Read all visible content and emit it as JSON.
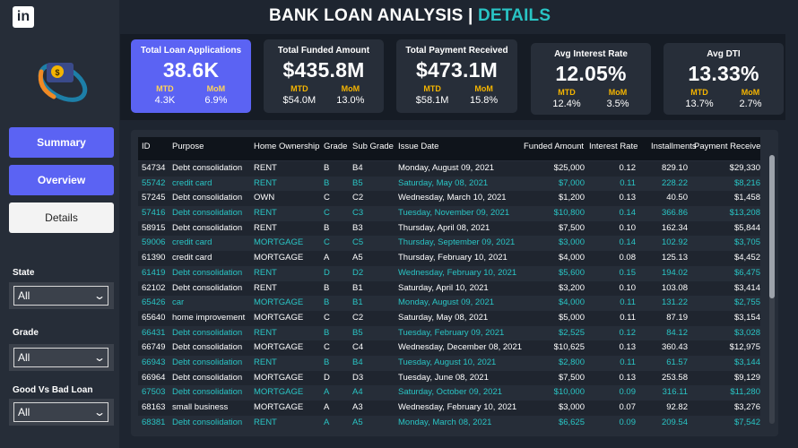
{
  "header": {
    "title_main": "BANK LOAN ANALYSIS | ",
    "title_accent": "DETAILS",
    "logo_letters": "in"
  },
  "nav": {
    "summary": "Summary",
    "overview": "Overview",
    "details": "Details"
  },
  "filters": {
    "state": {
      "label": "State",
      "value": "All"
    },
    "grade": {
      "label": "Grade",
      "value": "All"
    },
    "good_bad": {
      "label": "Good Vs Bad Loan",
      "value": "All"
    }
  },
  "kpis": [
    {
      "title": "Total Loan Applications",
      "value": "38.6K",
      "mtd_label": "MTD",
      "mom_label": "MoM",
      "mtd": "4.3K",
      "mom": "6.9%"
    },
    {
      "title": "Total Funded Amount",
      "value": "$435.8M",
      "mtd_label": "MTD",
      "mom_label": "MoM",
      "mtd": "$54.0M",
      "mom": "13.0%"
    },
    {
      "title": "Total Payment Received",
      "value": "$473.1M",
      "mtd_label": "MTD",
      "mom_label": "MoM",
      "mtd": "$58.1M",
      "mom": "15.8%"
    },
    {
      "title": "Avg Interest Rate",
      "value": "12.05%",
      "mtd_label": "MTD",
      "mom_label": "MoM",
      "mtd": "12.4%",
      "mom": "3.5%"
    },
    {
      "title": "Avg DTI",
      "value": "13.33%",
      "mtd_label": "MTD",
      "mom_label": "MoM",
      "mtd": "13.7%",
      "mom": "2.7%"
    }
  ],
  "colors": {
    "accent": "#29c4c4",
    "nav_active": "#5b63f3",
    "gold": "#f4b400",
    "bg": "#1e2530"
  },
  "table": {
    "columns": [
      "ID",
      "Purpose",
      "Home Ownership",
      "Grade",
      "Sub Grade",
      "Issue Date",
      "Funded Amount",
      "Interest Rate",
      "Installments",
      "Payment Received"
    ],
    "rows": [
      [
        "54734",
        "Debt consolidation",
        "RENT",
        "B",
        "B4",
        "Monday, August 09, 2021",
        "$25,000",
        "0.12",
        "829.10",
        "$29,330"
      ],
      [
        "55742",
        "credit card",
        "RENT",
        "B",
        "B5",
        "Saturday, May 08, 2021",
        "$7,000",
        "0.11",
        "228.22",
        "$8,216"
      ],
      [
        "57245",
        "Debt consolidation",
        "OWN",
        "C",
        "C2",
        "Wednesday, March 10, 2021",
        "$1,200",
        "0.13",
        "40.50",
        "$1,458"
      ],
      [
        "57416",
        "Debt consolidation",
        "RENT",
        "C",
        "C3",
        "Tuesday, November 09, 2021",
        "$10,800",
        "0.14",
        "366.86",
        "$13,208"
      ],
      [
        "58915",
        "Debt consolidation",
        "RENT",
        "B",
        "B3",
        "Thursday, April 08, 2021",
        "$7,500",
        "0.10",
        "162.34",
        "$5,844"
      ],
      [
        "59006",
        "credit card",
        "MORTGAGE",
        "C",
        "C5",
        "Thursday, September 09, 2021",
        "$3,000",
        "0.14",
        "102.92",
        "$3,705"
      ],
      [
        "61390",
        "credit card",
        "MORTGAGE",
        "A",
        "A5",
        "Thursday, February 10, 2021",
        "$4,000",
        "0.08",
        "125.13",
        "$4,452"
      ],
      [
        "61419",
        "Debt consolidation",
        "RENT",
        "D",
        "D2",
        "Wednesday, February 10, 2021",
        "$5,600",
        "0.15",
        "194.02",
        "$6,475"
      ],
      [
        "62102",
        "Debt consolidation",
        "RENT",
        "B",
        "B1",
        "Saturday, April 10, 2021",
        "$3,200",
        "0.10",
        "103.08",
        "$3,414"
      ],
      [
        "65426",
        "car",
        "MORTGAGE",
        "B",
        "B1",
        "Monday, August 09, 2021",
        "$4,000",
        "0.11",
        "131.22",
        "$2,755"
      ],
      [
        "65640",
        "home improvement",
        "MORTGAGE",
        "C",
        "C2",
        "Saturday, May 08, 2021",
        "$5,000",
        "0.11",
        "87.19",
        "$3,154"
      ],
      [
        "66431",
        "Debt consolidation",
        "RENT",
        "B",
        "B5",
        "Tuesday, February 09, 2021",
        "$2,525",
        "0.12",
        "84.12",
        "$3,028"
      ],
      [
        "66749",
        "Debt consolidation",
        "MORTGAGE",
        "C",
        "C4",
        "Wednesday, December 08, 2021",
        "$10,625",
        "0.13",
        "360.43",
        "$12,975"
      ],
      [
        "66943",
        "Debt consolidation",
        "RENT",
        "B",
        "B4",
        "Tuesday, August 10, 2021",
        "$2,800",
        "0.11",
        "61.57",
        "$3,144"
      ],
      [
        "66964",
        "Debt consolidation",
        "MORTGAGE",
        "D",
        "D3",
        "Tuesday, June 08, 2021",
        "$7,500",
        "0.13",
        "253.58",
        "$9,129"
      ],
      [
        "67503",
        "Debt consolidation",
        "MORTGAGE",
        "A",
        "A4",
        "Saturday, October 09, 2021",
        "$10,000",
        "0.09",
        "316.11",
        "$11,280"
      ],
      [
        "68163",
        "small business",
        "MORTGAGE",
        "A",
        "A3",
        "Wednesday, February 10, 2021",
        "$3,000",
        "0.07",
        "92.82",
        "$3,276"
      ],
      [
        "68381",
        "Debt consolidation",
        "RENT",
        "A",
        "A5",
        "Monday, March 08, 2021",
        "$6,625",
        "0.09",
        "209.54",
        "$7,542"
      ]
    ]
  }
}
